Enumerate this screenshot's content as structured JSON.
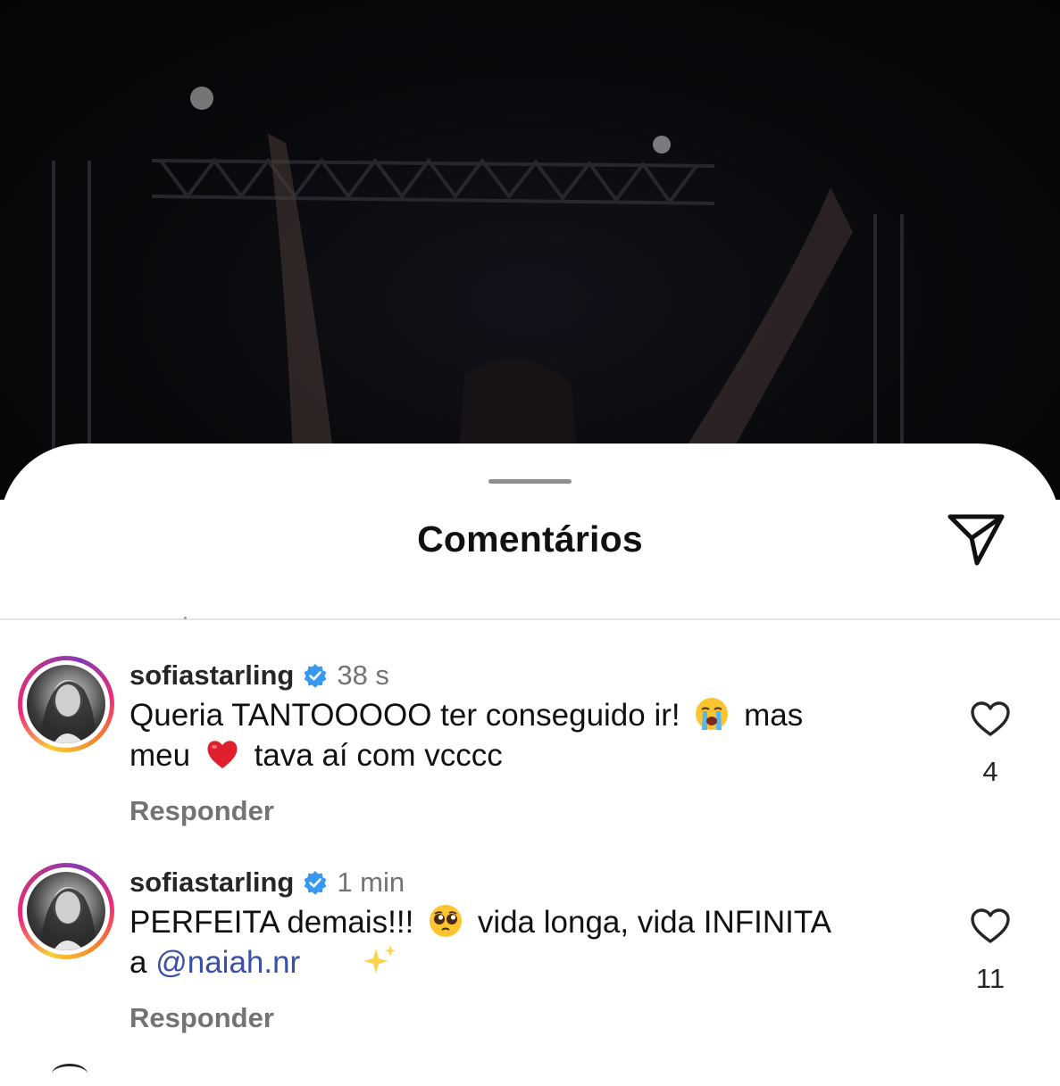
{
  "sheet": {
    "title": "Comentários",
    "share_icon": "paper-plane-icon"
  },
  "comments": [
    {
      "username": "sofiastarling",
      "verified": true,
      "timestamp": "38 s",
      "text_line1_part1": "Queria TANTOOOOO ter conseguido ir!",
      "emoji1": "loudly-crying-face-emoji",
      "text_line1_part2": "mas",
      "text_line2_part1": "meu",
      "emoji2": "red-heart-emoji",
      "text_line2_part2": "tava aí com vcccc",
      "reply_label": "Responder",
      "like_count": "4"
    },
    {
      "username": "sofiastarling",
      "verified": true,
      "timestamp": "1 min",
      "text_line1_part1": "PERFEITA demais!!!",
      "emoji1": "pleading-face-emoji",
      "text_line1_part2": "vida longa, vida INFINITA",
      "text_line2_part1": "a",
      "mention": "@naiah.nr",
      "emoji2": "sparkles-emoji",
      "reply_label": "Responder",
      "like_count": "11"
    }
  ],
  "colors": {
    "verified_badge": "#3897f0",
    "mention": "#3b4fa8",
    "secondary_text": "#737373"
  }
}
